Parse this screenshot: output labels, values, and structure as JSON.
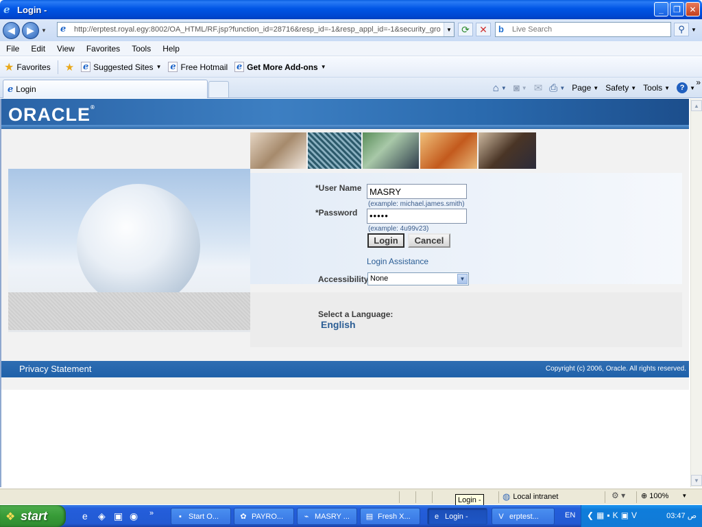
{
  "window": {
    "title": "Login -"
  },
  "address": {
    "url": "http://erptest.royal.egy:8002/OA_HTML/RF.jsp?function_id=28716&resp_id=-1&resp_appl_id=-1&security_gro",
    "search_placeholder": "Live Search"
  },
  "menu": [
    "File",
    "Edit",
    "View",
    "Favorites",
    "Tools",
    "Help"
  ],
  "favorites": {
    "label": "Favorites",
    "links": [
      {
        "label": "Suggested Sites",
        "dropdown": true
      },
      {
        "label": "Free Hotmail",
        "dropdown": false
      },
      {
        "label": "Get More Add-ons",
        "dropdown": true
      }
    ]
  },
  "tab": {
    "label": "Login"
  },
  "commandbar": {
    "page": "Page",
    "safety": "Safety",
    "tools": "Tools"
  },
  "oracle": {
    "logo": "ORACLE",
    "username_label": "*User Name",
    "username_value": "MASRY",
    "username_hint": "(example: michael.james.smith)",
    "password_label": "*Password",
    "password_value": "•••••",
    "password_hint": "(example: 4u99v23)",
    "login_button": "Login",
    "cancel_button": "Cancel",
    "login_assistance": "Login Assistance",
    "accessibility_label": "Accessibility",
    "accessibility_value": "None",
    "select_language": "Select a Language:",
    "language": "English",
    "privacy": "Privacy Statement",
    "copyright": "Copyright (c) 2006, Oracle. All rights reserved."
  },
  "statusbar": {
    "tooltip": "Login -",
    "zone": "Local intranet",
    "zoom": "100%"
  },
  "taskbar": {
    "start": "start",
    "tasks": [
      "Start O...",
      "PAYRO...",
      "MASRY ...",
      "Fresh X...",
      "Login -",
      "erptest..."
    ],
    "language": "EN",
    "clock": "03:47 ص"
  }
}
